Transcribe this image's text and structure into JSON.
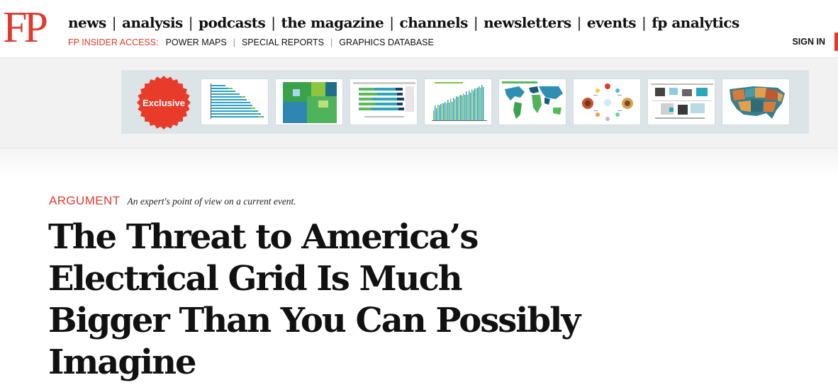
{
  "header": {
    "logo": "FP",
    "nav": [
      "news",
      "analysis",
      "podcasts",
      "the magazine",
      "channels",
      "newsletters",
      "events",
      "fp analytics"
    ],
    "insider_label": "FP INSIDER ACCESS:",
    "insider_links": [
      "POWER MAPS",
      "SPECIAL REPORTS",
      "GRAPHICS DATABASE"
    ],
    "sign_in": "SIGN IN"
  },
  "banner": {
    "badge": "Exclusive",
    "badge_color": "#e83b2a",
    "thumbnails": [
      "bar-chart",
      "treemap",
      "stacked-bar-chart",
      "column-chart",
      "world-map",
      "network-diagram",
      "infographic",
      "us-map"
    ]
  },
  "article": {
    "section": "ARGUMENT",
    "section_description": "An expert's point of view on a current event.",
    "headline": "The Threat to America’s Electrical Grid Is Much Bigger Than You Can Possibly Imagine"
  },
  "colors": {
    "accent": "#e03a2f"
  }
}
